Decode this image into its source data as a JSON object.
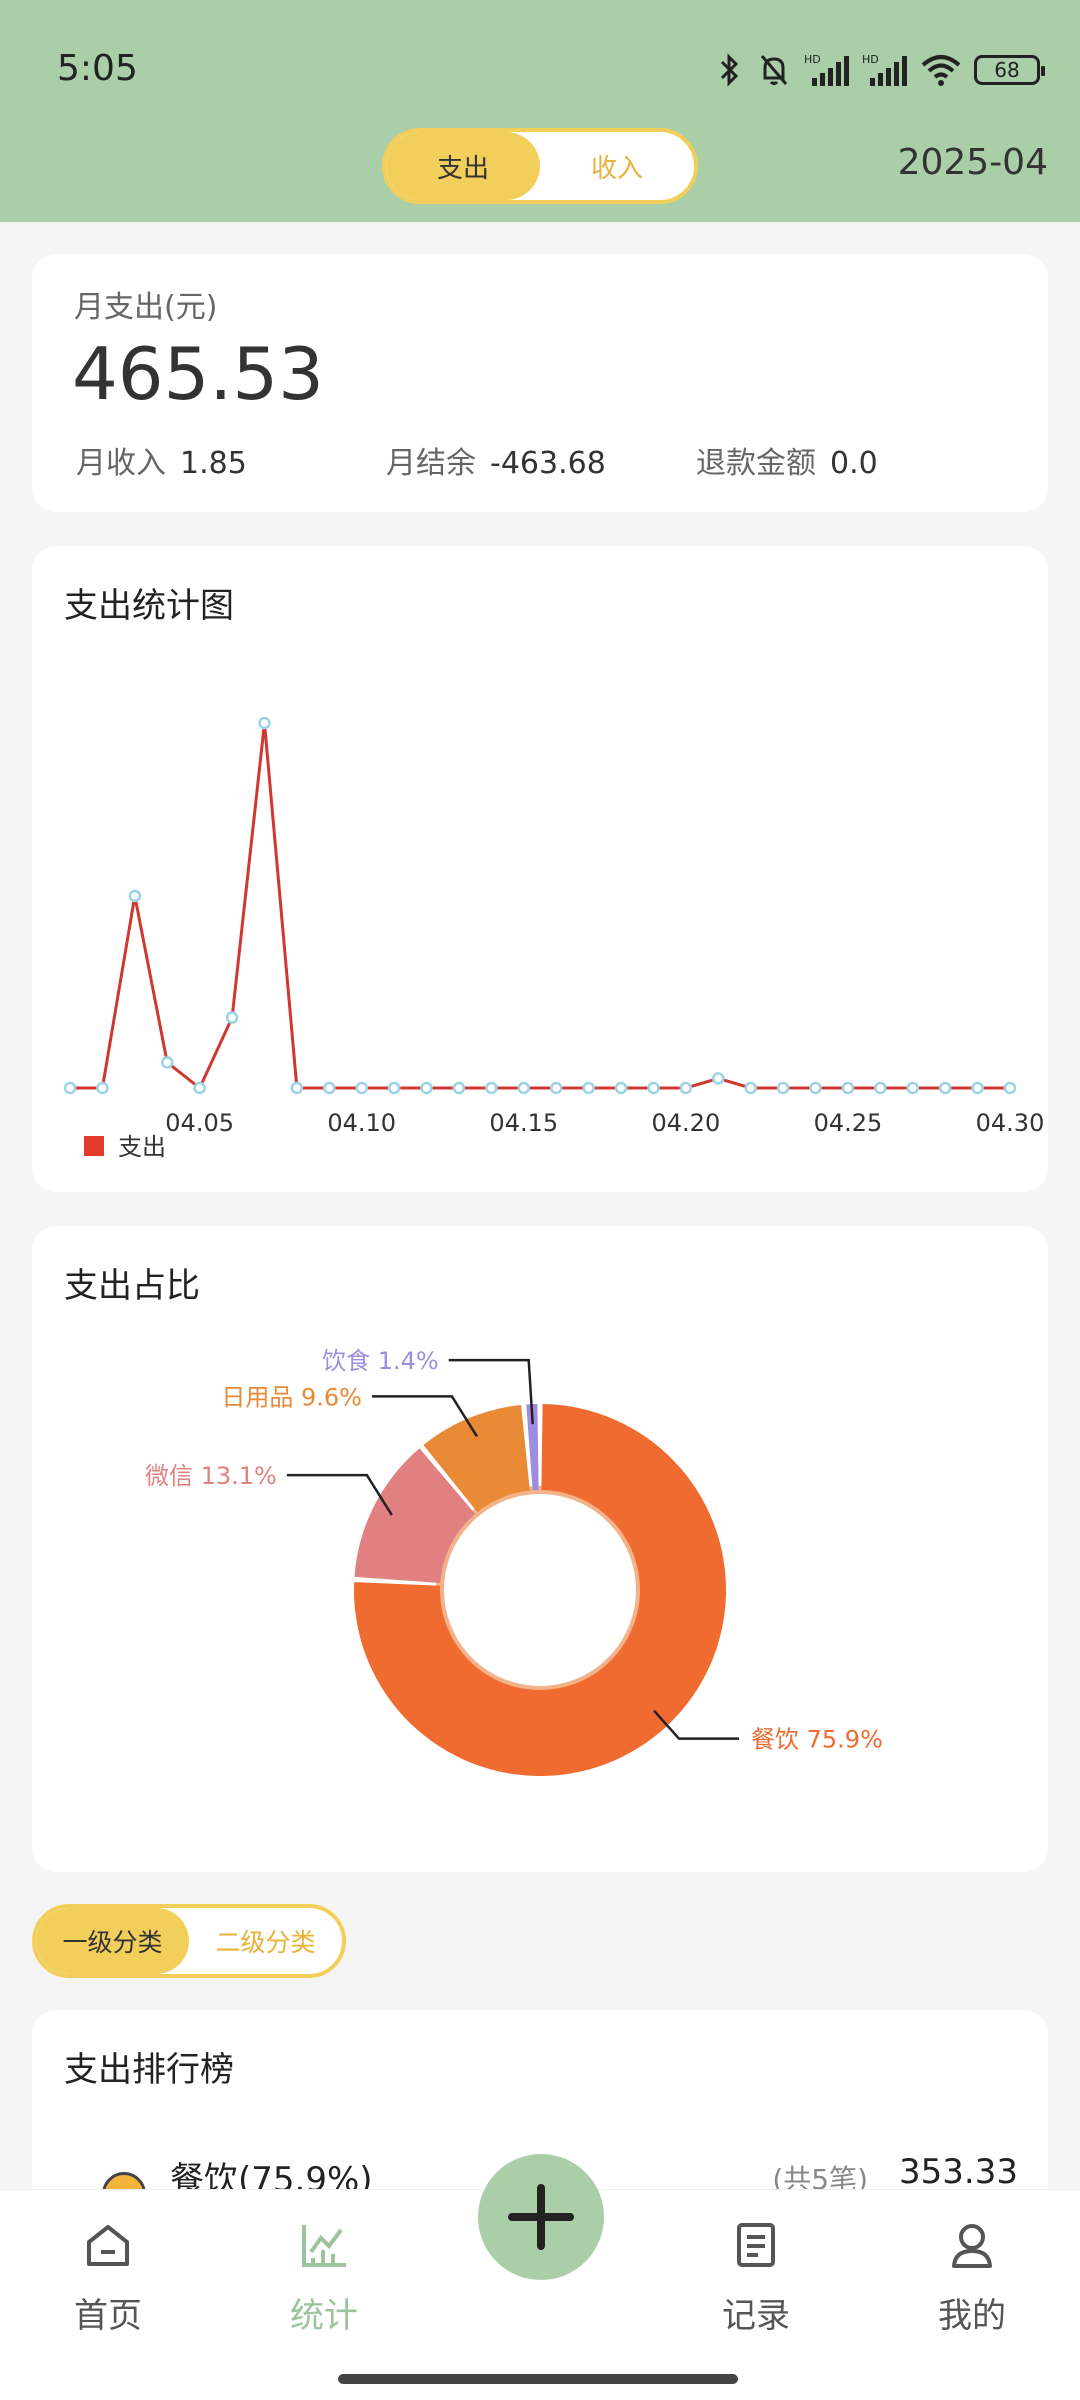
{
  "status": {
    "time": "5:05",
    "battery": "68"
  },
  "header": {
    "tabs": [
      "支出",
      "收入"
    ],
    "month": "2025-04"
  },
  "summary": {
    "label": "月支出(元)",
    "amount": "465.53",
    "income_label": "月收入",
    "income_value": "1.85",
    "balance_label": "月结余",
    "balance_value": "-463.68",
    "refund_label": "退款金额",
    "refund_value": "0.0"
  },
  "line_card": {
    "title": "支出统计图"
  },
  "pie_card": {
    "title": "支出占比"
  },
  "level_tabs": [
    "一级分类",
    "二级分类"
  ],
  "ranking": {
    "title": "支出排行榜",
    "items": [
      {
        "name": "餐饮(75.9%)",
        "count": "(共5笔)",
        "amount": "353.33"
      }
    ]
  },
  "tabbar": {
    "items": [
      "首页",
      "统计",
      "记录",
      "我的"
    ]
  },
  "colors": {
    "header": "#a9cea8",
    "accent": "#f2cf5b",
    "line": "#d0372e"
  },
  "chart_data": [
    {
      "type": "line",
      "x_ticks": [
        "04.05",
        "04.10",
        "04.15",
        "04.20",
        "04.25",
        "04.30"
      ],
      "series": [
        {
          "name": "支出",
          "x": [
            1,
            2,
            3,
            4,
            5,
            6,
            7,
            8,
            9,
            10,
            11,
            12,
            13,
            14,
            15,
            16,
            17,
            18,
            19,
            20,
            21,
            22,
            23,
            24,
            25,
            26,
            27,
            28,
            29,
            30
          ],
          "values": [
            0,
            0,
            60,
            8,
            0,
            22,
            114,
            0,
            0,
            0,
            0,
            0,
            0,
            0,
            0,
            0,
            0,
            0,
            0,
            0,
            3,
            0,
            0,
            0,
            0,
            0,
            0,
            0,
            0,
            0
          ]
        }
      ],
      "legend": "bottom-left",
      "grid": false
    },
    {
      "type": "pie",
      "labels": [
        "餐饮",
        "微信",
        "日用品",
        "饮食"
      ],
      "values": [
        75.9,
        13.1,
        9.6,
        1.4
      ],
      "value_labels": [
        "餐饮 75.9%",
        "微信 13.1%",
        "日用品 9.6%",
        "饮食 1.4%"
      ],
      "colors": [
        "#ef6b2f",
        "#e08080",
        "#e88a36",
        "#9d8cdf"
      ]
    }
  ]
}
